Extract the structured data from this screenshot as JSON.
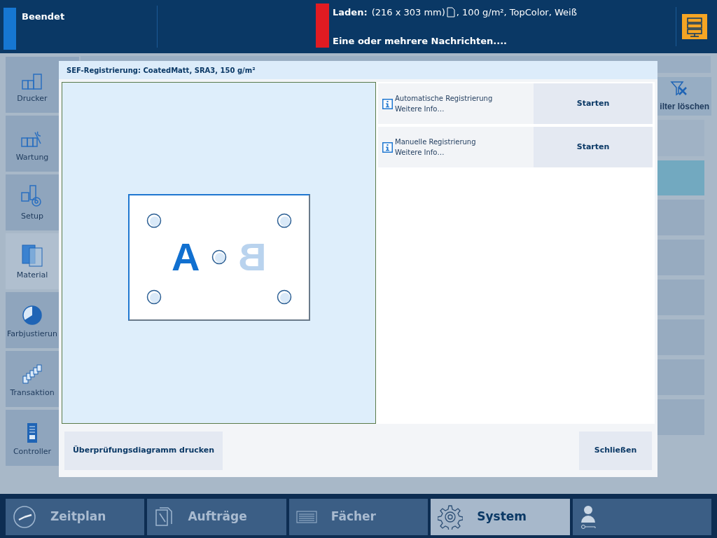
{
  "status_bar": {
    "job_status": "Beendet",
    "load_label": "Laden:",
    "load_detail_prefix": "(216 x 303 mm)",
    "load_detail_suffix": ", 100 g/m², TopColor, Weiß",
    "message": "Eine oder mehrere Nachrichten...."
  },
  "sidebar": {
    "items": [
      {
        "label": "Drucker",
        "selected": false
      },
      {
        "label": "Wartung",
        "selected": false
      },
      {
        "label": "Setup",
        "selected": false
      },
      {
        "label": "Material",
        "selected": true
      },
      {
        "label": "Farbjustierun",
        "selected": false
      },
      {
        "label": "Transaktion",
        "selected": false
      },
      {
        "label": "Controller",
        "selected": false
      }
    ]
  },
  "background_toolbar": {
    "filter_button": "ilter löschen"
  },
  "dialog": {
    "title": "SEF-Registrierung: CoatedMatt, SRA3, 150 g/m²",
    "diagram": {
      "front_letter": "A",
      "back_letter": "B"
    },
    "options": [
      {
        "title": "Automatische Registrierung",
        "info": "Weitere Info…",
        "button": "Starten"
      },
      {
        "title": "Manuelle Registrierung",
        "info": "Weitere Info…",
        "button": "Starten"
      }
    ],
    "print_button": "Überprüfungsdiagramm drucken",
    "close_button": "Schließen"
  },
  "bottom_nav": [
    {
      "label": "Zeitplan",
      "selected": false
    },
    {
      "label": "Aufträge",
      "selected": false
    },
    {
      "label": "Fächer",
      "selected": false
    },
    {
      "label": "System",
      "selected": true
    },
    {
      "selected": false
    }
  ]
}
